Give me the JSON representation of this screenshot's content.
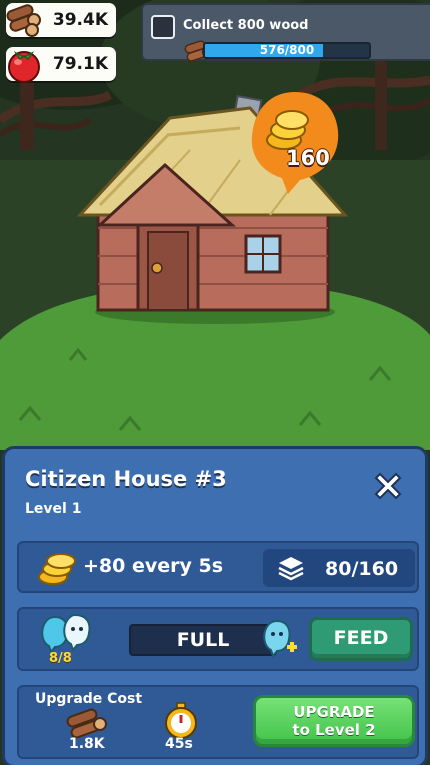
{
  "resources": {
    "wood": {
      "icon": "wood-logs-icon",
      "value": "39.4K"
    },
    "food": {
      "icon": "tomato-icon",
      "value": "79.1K"
    }
  },
  "quest": {
    "text": "Collect 800 wood",
    "progress_text": "576/800",
    "progress_fraction": 0.72,
    "icon": "wood-logs-icon"
  },
  "building_bubble": {
    "icon": "gold-coins-icon",
    "value": "160"
  },
  "panel": {
    "title": "Citizen House #3",
    "level": "Level 1",
    "close_icon": "close-icon",
    "income": "+80 every 5s",
    "capacity": "80/160",
    "citizens": "8/8",
    "food_status": "FULL",
    "feed_label": "FEED",
    "upgrade_cost_label": "Upgrade Cost",
    "wood_cost": "1.8K",
    "time_cost": "45s",
    "upgrade_button_line1": "UPGRADE",
    "upgrade_button_line2": "to Level 2"
  },
  "colors": {
    "panel_bg": "#3e6fb0",
    "feed_button": "#2f9b74",
    "upgrade_button": "#41c24a",
    "quest_bar": "#2fa8ee",
    "coin_bubble": "#f28a1c"
  }
}
